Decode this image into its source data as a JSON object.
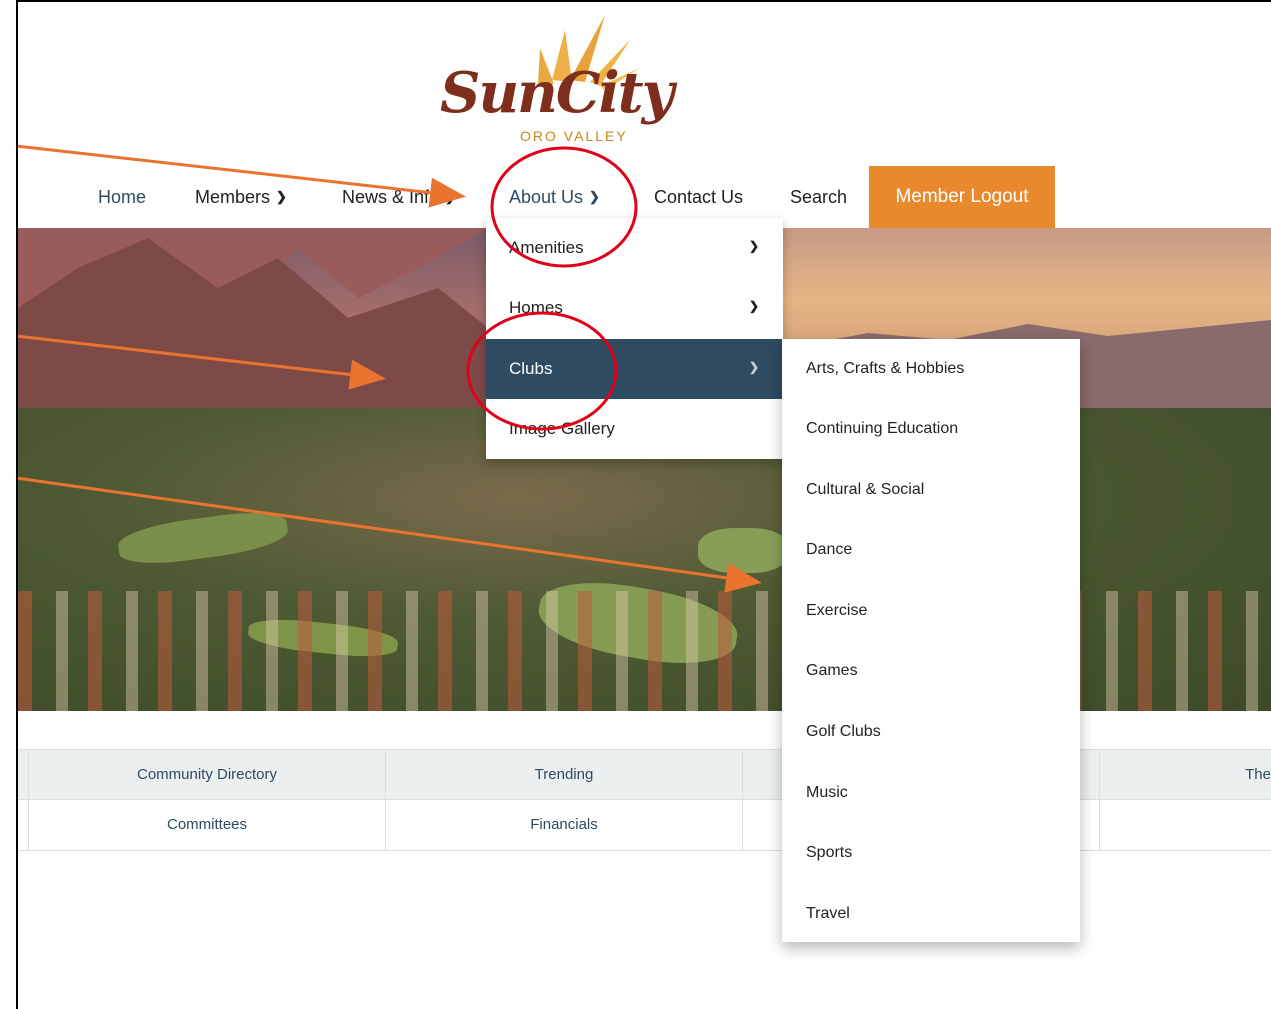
{
  "logo": {
    "name": "SunCity",
    "tagline": "ORO VALLEY"
  },
  "nav": {
    "home": "Home",
    "members": "Members",
    "news": "News & Info",
    "about": "About Us",
    "contact": "Contact Us",
    "search": "Search",
    "logout": "Member Logout"
  },
  "about_menu": {
    "items": [
      {
        "label": "Amenities",
        "has_submenu": true
      },
      {
        "label": "Homes",
        "has_submenu": true
      },
      {
        "label": "Clubs",
        "has_submenu": true,
        "active": true
      },
      {
        "label": "Image Gallery",
        "has_submenu": false
      }
    ]
  },
  "clubs_menu": {
    "items": [
      "Arts, Crafts & Hobbies",
      "Continuing Education",
      "Cultural & Social",
      "Dance",
      "Exercise",
      "Games",
      "Golf Clubs",
      "Music",
      "Sports",
      "Travel"
    ]
  },
  "links": {
    "row1": [
      "Community Directory",
      "Trending",
      "",
      "The"
    ],
    "row2": [
      "Committees",
      "Financials",
      "",
      ""
    ]
  },
  "colors": {
    "nav_accent": "#2e4b62",
    "logout_bg": "#e8892e",
    "annotation_arrow": "#e87430",
    "annotation_circle": "#e0001a"
  },
  "icons": {
    "chevron": "chevron-down-icon",
    "sun": "sun-rays-icon"
  }
}
